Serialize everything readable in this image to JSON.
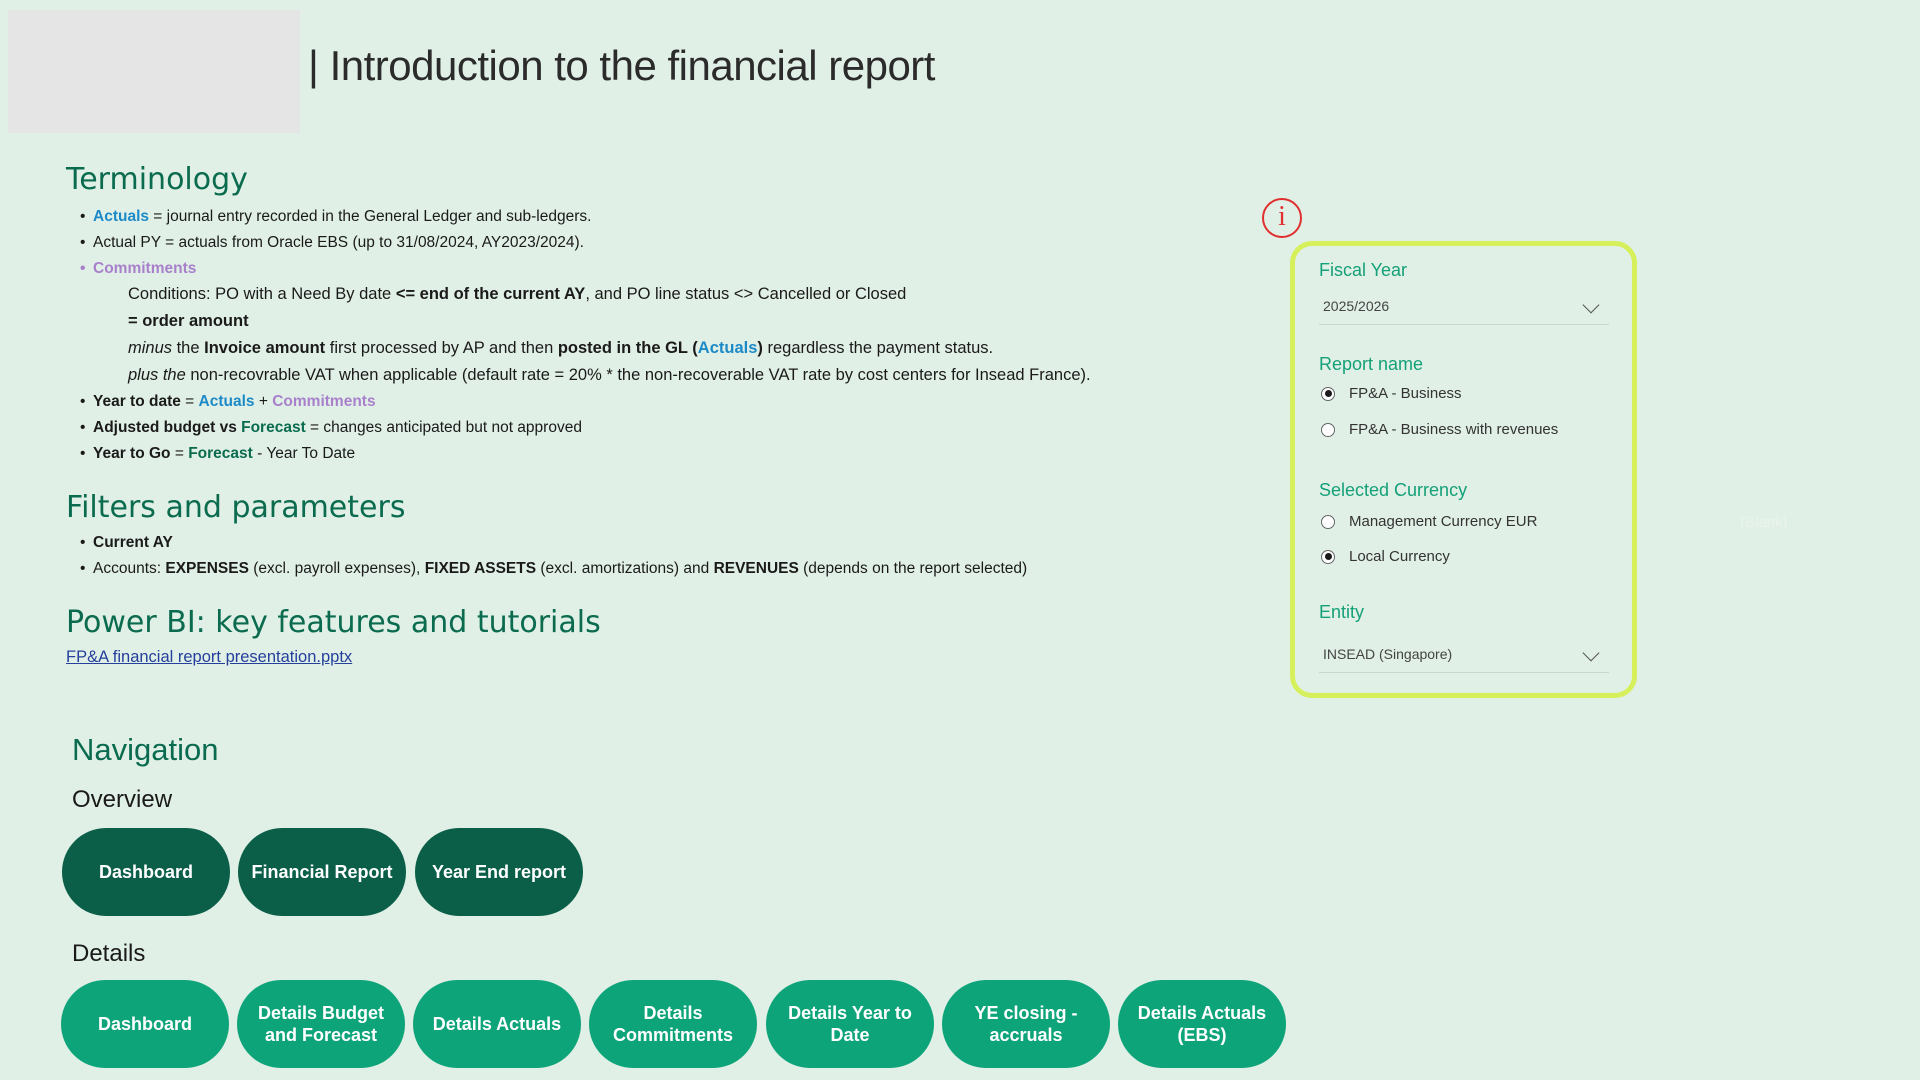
{
  "header": {
    "title": "| Introduction to the financial report"
  },
  "terminology": {
    "heading": "Terminology",
    "actuals_label": "Actuals",
    "actuals_def": " = journal entry recorded in the General Ledger and sub-ledgers.",
    "actual_py": "Actual PY = actuals from Oracle EBS (up to 31/08/2024, AY2023/2024).",
    "commitments_label": "Commitments",
    "cond_pre": "Conditions: PO with a Need By date ",
    "cond_bold": "<= end of the current AY",
    "cond_post": ", and PO line status <> Cancelled or Closed",
    "order_amount": "= order amount",
    "minus_i": "minus",
    "minus_1": " the ",
    "minus_b1": "Invoice amount",
    "minus_2": " first processed by AP and then ",
    "minus_b2": "posted in the GL (",
    "minus_actuals": "Actuals",
    "minus_b3": ")",
    "minus_3": " regardless the payment status.",
    "plus_i": "plus the",
    "plus_text": " non-recovrable VAT when applicable (default rate = 20%  * the non-recoverable VAT rate by cost centers for Insead France).",
    "ytd_label": "Year to date",
    "ytd_eq": " = ",
    "ytd_actuals": "Actuals",
    "ytd_plus": " + ",
    "ytd_commitments": "Commitments",
    "adj_label": "Adjusted budget vs ",
    "adj_forecast": "Forecast",
    "adj_def": " = changes anticipated but not approved",
    "ytg_label": "Year to Go",
    "ytg_eq": " = ",
    "ytg_forecast": "Forecast",
    "ytg_def": " - Year To Date"
  },
  "filters": {
    "heading": "Filters and parameters",
    "current_ay": "Current AY",
    "acc_pre": "Accounts: ",
    "acc_b1": "EXPENSES",
    "acc_1": " (excl. payroll expenses), ",
    "acc_b2": "FIXED ASSETS",
    "acc_2": " (excl. amortizations) and ",
    "acc_b3": "REVENUES",
    "acc_3": " (depends on the report selected)"
  },
  "powerbi": {
    "heading": "Power BI: key features and tutorials",
    "link": "FP&A financial report presentation.pptx"
  },
  "info_icon": "i",
  "slicers": {
    "fiscal_year_label": "Fiscal Year",
    "fiscal_year_value": "2025/2026",
    "report_name_label": "Report name",
    "report_options": [
      "FP&A - Business",
      "FP&A - Business with revenues"
    ],
    "report_selected": 0,
    "currency_label": "Selected Currency",
    "currency_options": [
      "Management Currency EUR",
      "Local Currency"
    ],
    "currency_selected": 1,
    "entity_label": "Entity",
    "entity_value": "INSEAD (Singapore)"
  },
  "blank_text": "(Blank)",
  "navigation": {
    "heading": "Navigation",
    "overview_label": "Overview",
    "overview_buttons": [
      "Dashboard",
      "Financial Report",
      "Year End report"
    ],
    "details_label": "Details",
    "details_buttons": [
      "Dashboard",
      "Details Budget and Forecast",
      "Details Actuals",
      "Details Commitments",
      "Details Year to Date",
      "YE closing - accruals",
      "Details Actuals (EBS)"
    ]
  }
}
